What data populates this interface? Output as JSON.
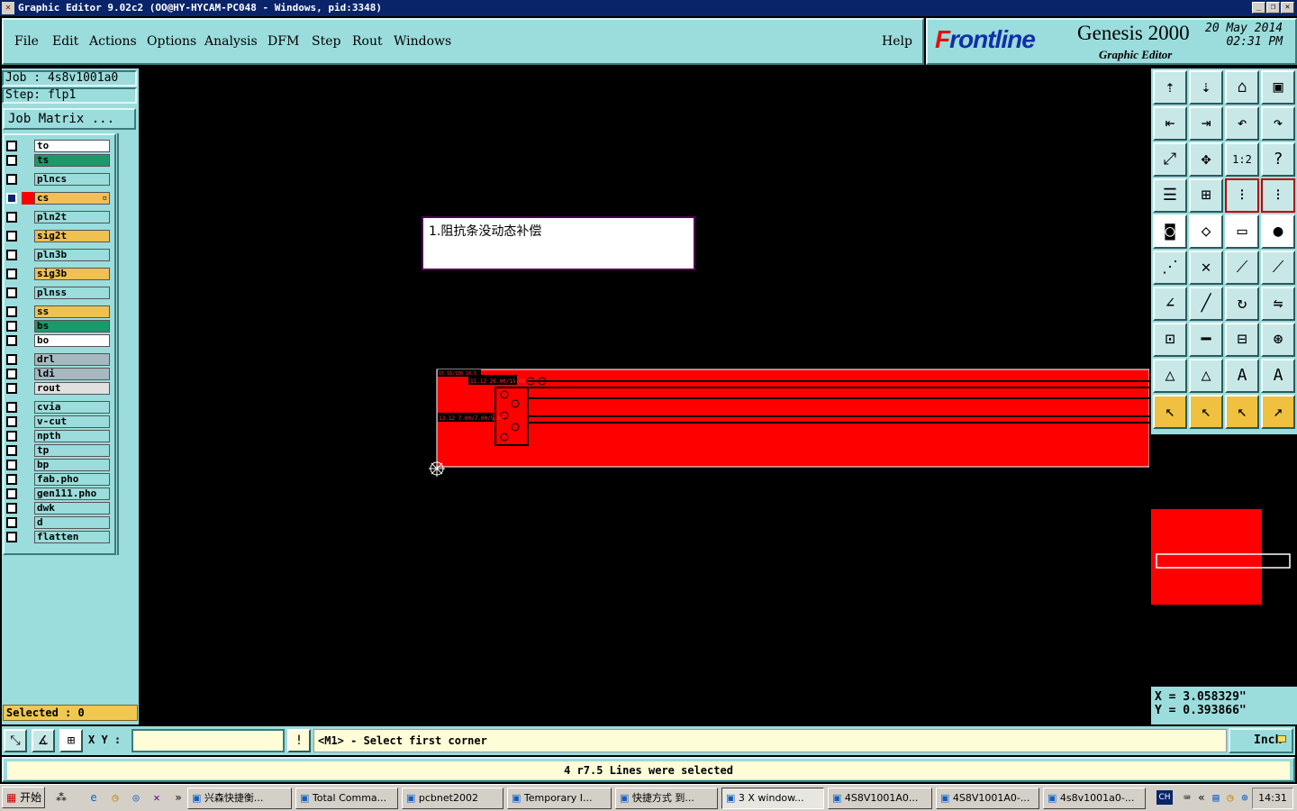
{
  "window": {
    "title": "Graphic Editor 9.02c2  (OO@HY-HYCAM-PC048 - Windows, pid:3348)",
    "controls": [
      "_",
      "❐",
      "✕"
    ]
  },
  "menu": {
    "items": [
      "File",
      "Edit",
      "Actions",
      "Options",
      "Analysis",
      "DFM",
      "Step",
      "Rout",
      "Windows"
    ],
    "help": "Help"
  },
  "brand": {
    "logo_prefix": "F",
    "logo_rest": "rontline",
    "product": "Genesis 2000",
    "subtitle": "Graphic Editor",
    "date": "20 May 2014",
    "time": "02:31 PM"
  },
  "job": {
    "job_line": "Job : 4s8v1001a0",
    "step_line": "Step: flp1",
    "matrix_button": "Job Matrix ..."
  },
  "layers": [
    {
      "name": "to",
      "color": "#ffffff",
      "active": false
    },
    {
      "name": "ts",
      "color": "#1a9a6a",
      "active": false
    },
    {
      "name": "plncs",
      "color": "#9bdcdc",
      "active": false
    },
    {
      "name": "cs",
      "color": "#f0c050",
      "active": true
    },
    {
      "name": "pln2t",
      "color": "#9bdcdc",
      "active": false
    },
    {
      "name": "sig2t",
      "color": "#f0c050",
      "active": false
    },
    {
      "name": "pln3b",
      "color": "#9bdcdc",
      "active": false
    },
    {
      "name": "sig3b",
      "color": "#f0c050",
      "active": false
    },
    {
      "name": "plnss",
      "color": "#9bdcdc",
      "active": false
    },
    {
      "name": "ss",
      "color": "#f0c050",
      "active": false
    },
    {
      "name": "bs",
      "color": "#1a9a6a",
      "active": false
    },
    {
      "name": "bo",
      "color": "#ffffff",
      "active": false
    },
    {
      "name": "drl",
      "color": "#a8b8c0",
      "active": false
    },
    {
      "name": "ldi",
      "color": "#a8b8c0",
      "active": false
    },
    {
      "name": "rout",
      "color": "#e0e0e0",
      "active": false
    },
    {
      "name": "cvia",
      "color": "#9bdcdc",
      "active": false
    },
    {
      "name": "v-cut",
      "color": "#9bdcdc",
      "active": false
    },
    {
      "name": "npth",
      "color": "#9bdcdc",
      "active": false
    },
    {
      "name": "tp",
      "color": "#9bdcdc",
      "active": false
    },
    {
      "name": "bp",
      "color": "#9bdcdc",
      "active": false
    },
    {
      "name": "fab.pho",
      "color": "#9bdcdc",
      "active": false
    },
    {
      "name": "gen111.pho",
      "color": "#9bdcdc",
      "active": false
    },
    {
      "name": "dwk",
      "color": "#9bdcdc",
      "active": false
    },
    {
      "name": "d",
      "color": "#9bdcdc",
      "active": false
    },
    {
      "name": "flatten",
      "color": "#9bdcdc",
      "active": false
    }
  ],
  "selected_label": "Selected : 0",
  "canvas": {
    "note": "1.阻抗条没动态补偿",
    "feature_color": "#ff0000",
    "pcb_labels": [
      "13.12 7.00/7.00/5.00",
      "11.12 26.00/15.00",
      "15 16/100 10.5"
    ]
  },
  "tools": [
    {
      "name": "open-job-icon",
      "glyph": "⇡",
      "style": ""
    },
    {
      "name": "save-icon",
      "glyph": "⇣",
      "style": ""
    },
    {
      "name": "home-icon",
      "glyph": "⌂",
      "style": ""
    },
    {
      "name": "window-icon",
      "glyph": "▣",
      "style": ""
    },
    {
      "name": "pan-left-icon",
      "glyph": "⇤",
      "style": ""
    },
    {
      "name": "pan-right-icon",
      "glyph": "⇥",
      "style": ""
    },
    {
      "name": "undo-icon",
      "glyph": "↶",
      "style": ""
    },
    {
      "name": "redo-icon",
      "glyph": "↷",
      "style": ""
    },
    {
      "name": "zoom-fit-icon",
      "glyph": "⤢",
      "style": ""
    },
    {
      "name": "zoom-center-icon",
      "glyph": "✥",
      "style": ""
    },
    {
      "name": "zoom-1to1-icon",
      "glyph": "1:2",
      "style": ""
    },
    {
      "name": "help-icon",
      "glyph": "?",
      "style": ""
    },
    {
      "name": "settings-icon",
      "glyph": "☰",
      "style": ""
    },
    {
      "name": "grid-icon",
      "glyph": "⊞",
      "style": ""
    },
    {
      "name": "snap-on-icon",
      "glyph": "⁝",
      "style": "rd"
    },
    {
      "name": "snap-off-icon",
      "glyph": "⁝",
      "style": "rd"
    },
    {
      "name": "feature-display-icon",
      "glyph": "◙",
      "style": "w"
    },
    {
      "name": "edit-shape-icon",
      "glyph": "◇",
      "style": "w"
    },
    {
      "name": "ruler-icon",
      "glyph": "▭",
      "style": "w"
    },
    {
      "name": "pad-icon",
      "glyph": "●",
      "style": "w"
    },
    {
      "name": "connect-icon",
      "glyph": "⋰",
      "style": ""
    },
    {
      "name": "delete-node-icon",
      "glyph": "✕",
      "style": ""
    },
    {
      "name": "add-node-icon",
      "glyph": "⟋",
      "style": ""
    },
    {
      "name": "move-node-icon",
      "glyph": "⟋",
      "style": ""
    },
    {
      "name": "angle-icon",
      "glyph": "∠",
      "style": ""
    },
    {
      "name": "line-icon",
      "glyph": "╱",
      "style": ""
    },
    {
      "name": "arc-icon",
      "glyph": "↻",
      "style": ""
    },
    {
      "name": "mirror-icon",
      "glyph": "⇋",
      "style": ""
    },
    {
      "name": "measure-point-icon",
      "glyph": "⊡",
      "style": ""
    },
    {
      "name": "measure-line-icon",
      "glyph": "━",
      "style": ""
    },
    {
      "name": "measure-box-icon",
      "glyph": "⊟",
      "style": ""
    },
    {
      "name": "measure-pads-icon",
      "glyph": "⊛",
      "style": ""
    },
    {
      "name": "triangle-icon",
      "glyph": "△",
      "style": ""
    },
    {
      "name": "triangle-2-icon",
      "glyph": "△",
      "style": ""
    },
    {
      "name": "a-icon",
      "glyph": "A",
      "style": ""
    },
    {
      "name": "a-mod-icon",
      "glyph": "A",
      "style": ""
    },
    {
      "name": "pointer-icon",
      "glyph": "↖",
      "style": "y"
    },
    {
      "name": "pointer-select-icon",
      "glyph": "↖",
      "style": "y"
    },
    {
      "name": "pointer-move-icon",
      "glyph": "↖",
      "style": "y"
    },
    {
      "name": "pointer-path-icon",
      "glyph": "↗",
      "style": "y"
    }
  ],
  "coords": {
    "x": "X = 3.058329\"",
    "y": "Y = 0.393866\""
  },
  "command": {
    "xy_label": "X Y :",
    "xy_value": "",
    "alert_glyph": "!",
    "prompt": "<M1> - Select first corner",
    "unit": "Inch"
  },
  "status_message": "4 r7.5 Lines were selected",
  "taskbar": {
    "start": "开始",
    "tasks": [
      {
        "label": "兴森快捷衡...",
        "active": false
      },
      {
        "label": "Total Comma...",
        "active": false
      },
      {
        "label": "pcbnet2002",
        "active": false
      },
      {
        "label": "Temporary I...",
        "active": false
      },
      {
        "label": "快捷方式 到...",
        "active": false
      },
      {
        "label": "3 X window...",
        "active": true
      },
      {
        "label": "4S8V1001A0...",
        "active": false
      },
      {
        "label": "4S8V1001A0-...",
        "active": false
      },
      {
        "label": "4s8v1001a0-...",
        "active": false
      }
    ],
    "lang": "CH",
    "clock": "14:31"
  }
}
